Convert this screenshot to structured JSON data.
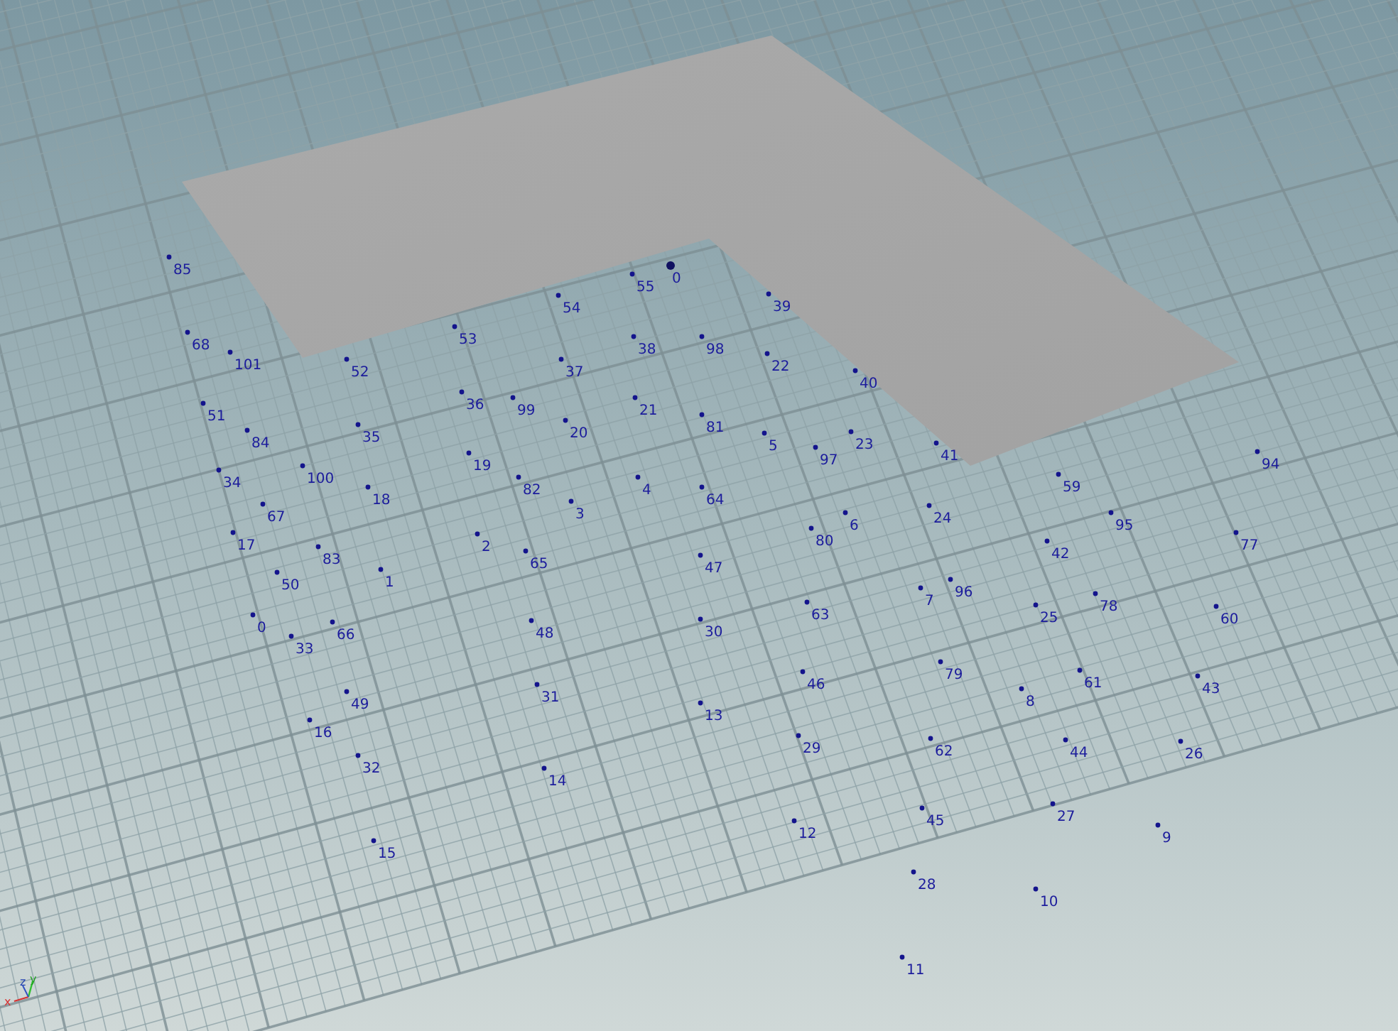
{
  "viewport": {
    "points": [
      {
        "label": "85",
        "highlighted": false
      },
      {
        "label": "55",
        "highlighted": false
      },
      {
        "label": "0",
        "highlighted": true
      },
      {
        "label": "54",
        "highlighted": false
      },
      {
        "label": "39",
        "highlighted": false
      },
      {
        "label": "68",
        "highlighted": false
      },
      {
        "label": "101",
        "highlighted": false
      },
      {
        "label": "52",
        "highlighted": false
      },
      {
        "label": "53",
        "highlighted": false
      },
      {
        "label": "37",
        "highlighted": false
      },
      {
        "label": "38",
        "highlighted": false
      },
      {
        "label": "98",
        "highlighted": false
      },
      {
        "label": "22",
        "highlighted": false
      },
      {
        "label": "40",
        "highlighted": false
      },
      {
        "label": "51",
        "highlighted": false
      },
      {
        "label": "84",
        "highlighted": false
      },
      {
        "label": "35",
        "highlighted": false
      },
      {
        "label": "36",
        "highlighted": false
      },
      {
        "label": "99",
        "highlighted": false
      },
      {
        "label": "20",
        "highlighted": false
      },
      {
        "label": "21",
        "highlighted": false
      },
      {
        "label": "81",
        "highlighted": false
      },
      {
        "label": "5",
        "highlighted": false
      },
      {
        "label": "23",
        "highlighted": false
      },
      {
        "label": "19",
        "highlighted": false
      },
      {
        "label": "97",
        "highlighted": false
      },
      {
        "label": "41",
        "highlighted": false
      },
      {
        "label": "94",
        "highlighted": false
      },
      {
        "label": "34",
        "highlighted": false
      },
      {
        "label": "100",
        "highlighted": false
      },
      {
        "label": "18",
        "highlighted": false
      },
      {
        "label": "82",
        "highlighted": false
      },
      {
        "label": "4",
        "highlighted": false
      },
      {
        "label": "64",
        "highlighted": false
      },
      {
        "label": "59",
        "highlighted": false
      },
      {
        "label": "67",
        "highlighted": false
      },
      {
        "label": "3",
        "highlighted": false
      },
      {
        "label": "6",
        "highlighted": false
      },
      {
        "label": "24",
        "highlighted": false
      },
      {
        "label": "95",
        "highlighted": false
      },
      {
        "label": "17",
        "highlighted": false
      },
      {
        "label": "83",
        "highlighted": false
      },
      {
        "label": "2",
        "highlighted": false
      },
      {
        "label": "65",
        "highlighted": false
      },
      {
        "label": "47",
        "highlighted": false
      },
      {
        "label": "80",
        "highlighted": false
      },
      {
        "label": "42",
        "highlighted": false
      },
      {
        "label": "77",
        "highlighted": false
      },
      {
        "label": "50",
        "highlighted": false
      },
      {
        "label": "1",
        "highlighted": false
      },
      {
        "label": "96",
        "highlighted": false
      },
      {
        "label": "0",
        "highlighted": false
      },
      {
        "label": "33",
        "highlighted": false
      },
      {
        "label": "66",
        "highlighted": false
      },
      {
        "label": "48",
        "highlighted": false
      },
      {
        "label": "30",
        "highlighted": false
      },
      {
        "label": "63",
        "highlighted": false
      },
      {
        "label": "7",
        "highlighted": false
      },
      {
        "label": "25",
        "highlighted": false
      },
      {
        "label": "78",
        "highlighted": false
      },
      {
        "label": "60",
        "highlighted": false
      },
      {
        "label": "49",
        "highlighted": false
      },
      {
        "label": "31",
        "highlighted": false
      },
      {
        "label": "46",
        "highlighted": false
      },
      {
        "label": "79",
        "highlighted": false
      },
      {
        "label": "8",
        "highlighted": false
      },
      {
        "label": "61",
        "highlighted": false
      },
      {
        "label": "43",
        "highlighted": false
      },
      {
        "label": "16",
        "highlighted": false
      },
      {
        "label": "32",
        "highlighted": false
      },
      {
        "label": "14",
        "highlighted": false
      },
      {
        "label": "13",
        "highlighted": false
      },
      {
        "label": "29",
        "highlighted": false
      },
      {
        "label": "62",
        "highlighted": false
      },
      {
        "label": "44",
        "highlighted": false
      },
      {
        "label": "26",
        "highlighted": false
      },
      {
        "label": "15",
        "highlighted": false
      },
      {
        "label": "12",
        "highlighted": false
      },
      {
        "label": "45",
        "highlighted": false
      },
      {
        "label": "27",
        "highlighted": false
      },
      {
        "label": "9",
        "highlighted": false
      },
      {
        "label": "28",
        "highlighted": false
      },
      {
        "label": "10",
        "highlighted": false
      },
      {
        "label": "11",
        "highlighted": false
      }
    ],
    "axis_gizmo": {
      "x_label": "x",
      "y_label": "y",
      "z_label": "z"
    }
  }
}
